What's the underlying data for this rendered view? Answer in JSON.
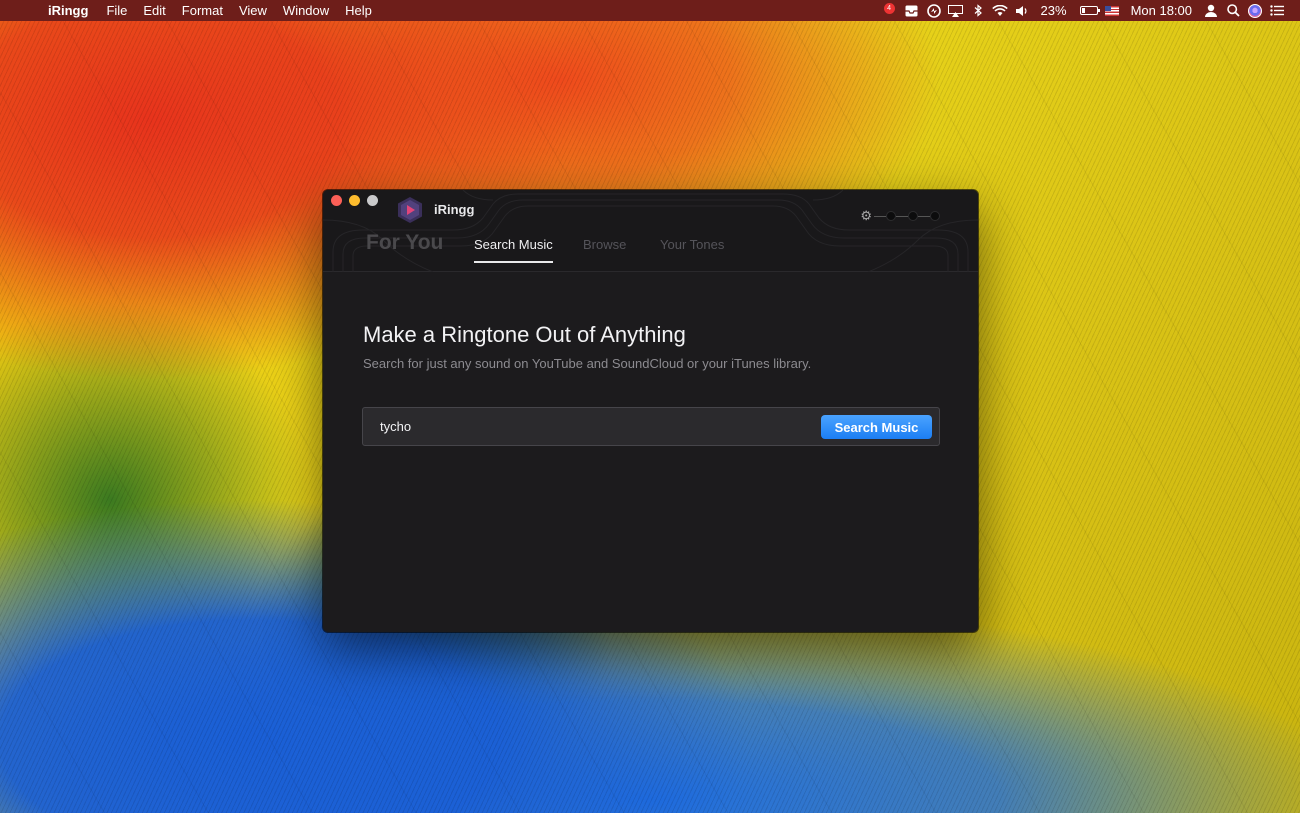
{
  "menubar": {
    "apple_glyph": "",
    "app_name": "iRingg",
    "menus": [
      "File",
      "Edit",
      "Format",
      "View",
      "Window",
      "Help"
    ],
    "notification_count": "4",
    "battery_percent": "23%",
    "battery_level": 0.23,
    "clock": "Mon 18:00",
    "icons": [
      "notification-icon",
      "inbox-icon",
      "sync-icon",
      "airplay-icon",
      "bluetooth-icon",
      "wifi-icon",
      "volume-icon",
      "battery-icon",
      "flag-icon",
      "user-icon",
      "spotlight-icon",
      "siri-icon",
      "notification-center-icon"
    ]
  },
  "window": {
    "title": "iRingg",
    "tabs": {
      "for_you": "For You",
      "search_music": "Search Music",
      "browse": "Browse",
      "your_tones": "Your Tones"
    },
    "active_tab": "Search Music",
    "headline": "Make a Ringtone Out of Anything",
    "subline": "Search for just any sound on YouTube and SoundCloud or your iTunes library.",
    "search": {
      "value": "tycho",
      "button_label": "Search Music"
    },
    "colors": {
      "accent": "#1c7ef3",
      "background": "#1c1b1d"
    }
  }
}
